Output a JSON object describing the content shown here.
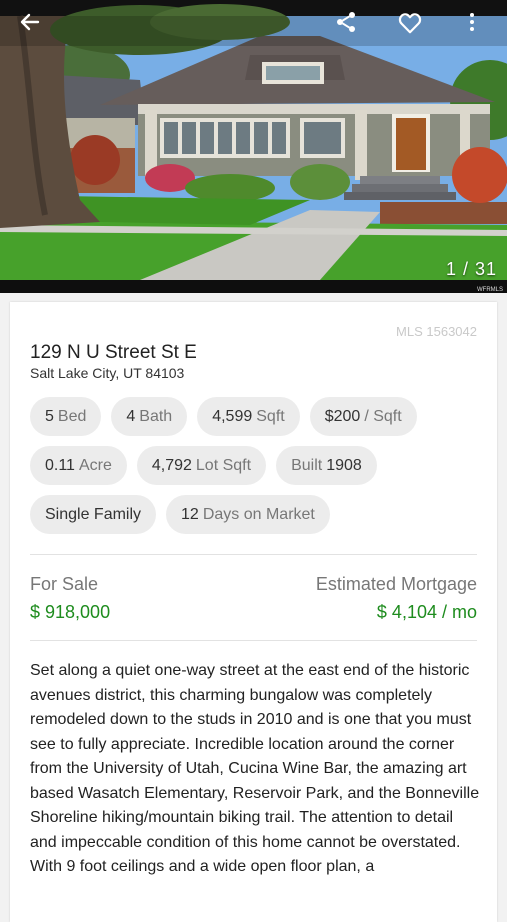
{
  "gallery": {
    "counter": "1 / 31",
    "watermark": "WFRMLS"
  },
  "toolbar": {
    "back_icon": "arrow-left-icon",
    "share_icon": "share-icon",
    "favorite_icon": "heart-outline-icon",
    "more_icon": "more-vertical-icon"
  },
  "listing": {
    "mls": "MLS 1563042",
    "address_line1": "129 N U Street St E",
    "address_line2": "Salt Lake City, UT 84103"
  },
  "chips": {
    "beds_value": "5",
    "beds_label": "Bed",
    "baths_value": "4",
    "baths_label": "Bath",
    "sqft_value": "4,599",
    "sqft_label": "Sqft",
    "ppsf_value": "$200",
    "ppsf_label": "/ Sqft",
    "acre_value": "0.11",
    "acre_label": "Acre",
    "lot_value": "4,792",
    "lot_label": "Lot Sqft",
    "built_label": "Built",
    "built_value": "1908",
    "type_value": "Single Family",
    "dom_value": "12",
    "dom_label": "Days on Market"
  },
  "pricing": {
    "status_label": "For Sale",
    "price": "$ 918,000",
    "mortgage_label": "Estimated Mortgage",
    "mortgage_value": "$ 4,104 / mo"
  },
  "description": "Set along a quiet one-way street at the east end of the historic avenues district, this charming bungalow was completely remodeled down to the studs in 2010 and is one that you must see to fully appreciate. Incredible location around the corner from the University of Utah, Cucina Wine Bar, the amazing art based Wasatch Elementary, Reservoir Park, and the Bonneville Shoreline hiking/mountain biking trail. The attention to detail and impeccable condition of this home cannot be overstated. With 9 foot ceilings and a wide open floor plan, a",
  "colors": {
    "price_green": "#1e8c1e",
    "chip_bg": "#ececec"
  }
}
